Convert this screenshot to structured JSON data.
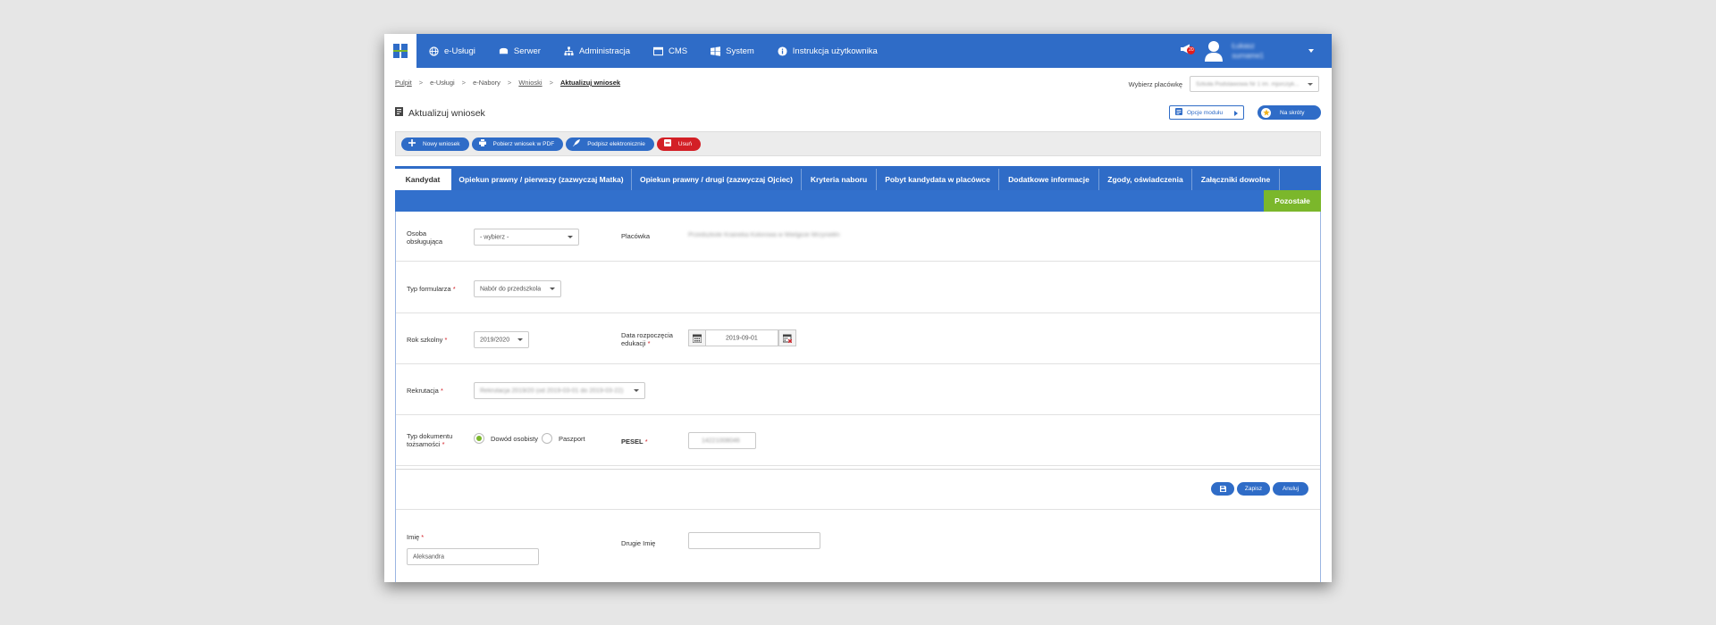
{
  "nav": {
    "items": [
      {
        "label": "e-Usługi",
        "icon": "globe-icon"
      },
      {
        "label": "Serwer",
        "icon": "server-icon"
      },
      {
        "label": "Administracja",
        "icon": "sitemap-icon"
      },
      {
        "label": "CMS",
        "icon": "window-icon"
      },
      {
        "label": "System",
        "icon": "windows-icon"
      },
      {
        "label": "Instrukcja użytkownika",
        "icon": "info-icon"
      }
    ],
    "notification_badge": "20",
    "user_name": "Łukasz",
    "user_surname": "surname1"
  },
  "breadcrumb": {
    "items": [
      "Pulpit",
      "e-Usługi",
      "e-Nabory",
      "Wnioski",
      "Aktualizuj wniosek"
    ],
    "separator": ">"
  },
  "placowka_picker": {
    "label": "Wybierz placówkę",
    "value": "Szkoła Podstawowa Nr 1 im. mjorczyk..."
  },
  "page": {
    "title": "Aktualizuj wniosek",
    "module_options": "Opcje modułu",
    "shortcuts": "Na skróty"
  },
  "toolbar": {
    "new": "Nowy wniosek",
    "pdf": "Pobierz wniosek w PDF",
    "sign": "Podpisz elektronicznie",
    "delete": "Usuń"
  },
  "tabs": [
    "Kandydat",
    "Opiekun prawny / pierwszy (zazwyczaj Matka)",
    "Opiekun prawny / drugi (zazwyczaj Ojciec)",
    "Kryteria naboru",
    "Pobyt kandydata w placówce",
    "Dodatkowe informacje",
    "Zgody, oświadczenia",
    "Załączniki dowolne",
    "Pozostałe"
  ],
  "form": {
    "osoba_label_1": "Osoba",
    "osoba_label_2": "obsługująca",
    "osoba_value": "- wybierz -",
    "placowka_label": "Placówka",
    "placowka_value": "Przedszkole Kraineka Kolorowa w Wielgicie Mrzyniełm",
    "typ_formularza_label": "Typ formularza",
    "typ_formularza_value": "Nabór do przedszkola",
    "rok_label": "Rok szkolny",
    "rok_value": "2019/2020",
    "data_label_1": "Data rozpoczęcia",
    "data_label_2": "edukacji",
    "data_value": "2019-09-01",
    "rekrutacja_label": "Rekrutacja",
    "rekrutacja_value": "Rekrutacja 2019/20 (od 2019-03-01 do 2019-03-22)",
    "typ_dok_label_1": "Typ dokumentu",
    "typ_dok_label_2": "tożsamości",
    "radio_1": "Dowód osobisty",
    "radio_2": "Paszport",
    "pesel_label": "PESEL",
    "pesel_value": "14221008046",
    "save": "Zapisz",
    "cancel": "Anuluj",
    "imie_label": "Imię",
    "imie_value": "Aleksandra",
    "drugie_imie_label": "Drugie Imię",
    "drugie_imie_value": "",
    "required_mark": "*"
  },
  "colors": {
    "primary": "#2f6cc7",
    "danger": "#d31f26",
    "success": "#7bb72b"
  }
}
